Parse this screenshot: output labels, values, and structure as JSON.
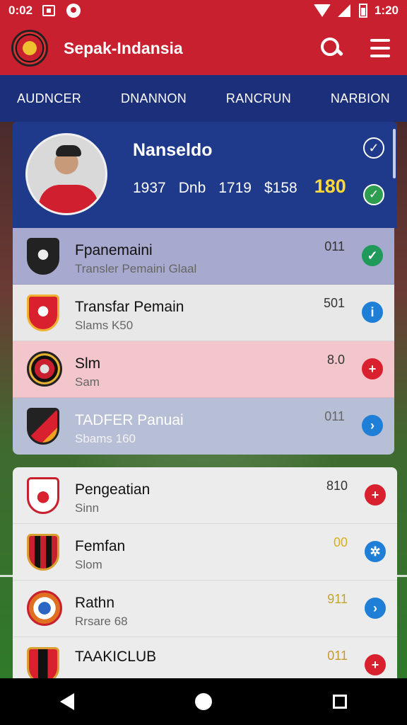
{
  "status_bar": {
    "time_left": "0:02",
    "time_right": "1:20"
  },
  "app_bar": {
    "title": "Sepak-Indansia"
  },
  "tabs": [
    {
      "label": "AUDNCER"
    },
    {
      "label": "DNANNON"
    },
    {
      "label": "RANCRUN"
    },
    {
      "label": "NARBION"
    }
  ],
  "profile": {
    "name": "Nanseldo",
    "stats": [
      "1937",
      "Dnb",
      "1719",
      "$158"
    ],
    "highlight": "180"
  },
  "group1": [
    {
      "title": "Fpanemaini",
      "sub": "Transler Pemaini Glaal",
      "value": "011",
      "action": "check",
      "bg": "#a7a9cf"
    },
    {
      "title": "Transfar Pemain",
      "sub": "Slams K50",
      "value": "501",
      "action": "info",
      "bg": "#e8e8e8"
    },
    {
      "title": "Slm",
      "sub": "Sam",
      "value": "8.0",
      "action": "plus",
      "bg": "#f2c6cb"
    },
    {
      "title": "TADFER Panuai",
      "sub": "Sbams 160",
      "value": "011",
      "action": "arrow",
      "bg": "#b7bfd6"
    }
  ],
  "group2": [
    {
      "title": "Pengeatian",
      "sub": "Sinn",
      "value": "810",
      "action": "plus",
      "value_color": "#333"
    },
    {
      "title": "Femfan",
      "sub": "Slom",
      "value": "00",
      "action": "star",
      "value_color": "#d4b21a"
    },
    {
      "title": "Rathn",
      "sub": "Rrsare 68",
      "value": "911",
      "action": "arrow",
      "value_color": "#c2a62a"
    },
    {
      "title": "TAAKICLUB",
      "sub": "",
      "value": "011",
      "action": "plus",
      "value_color": "#c89a2a"
    }
  ]
}
